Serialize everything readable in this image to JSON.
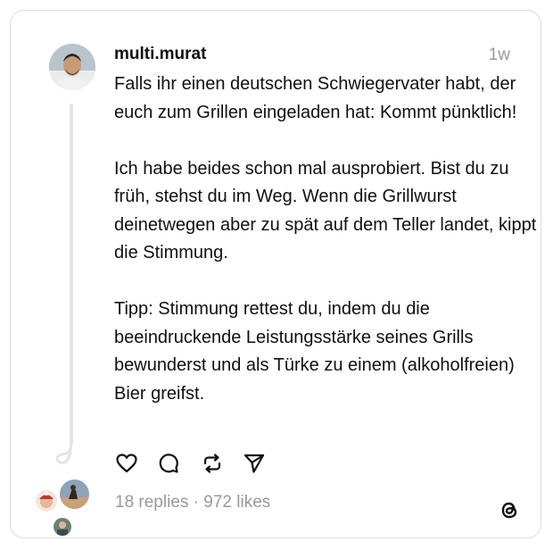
{
  "post": {
    "username": "multi.murat",
    "timestamp": "1w",
    "paragraphs": [
      "Falls ihr einen deutschen Schwiegervater habt, der euch zum Grillen eingeladen hat: Kommt pünktlich!",
      "Ich habe beides schon mal ausprobiert. Bist du zu früh, stehst du im Weg. Wenn die Grillwurst deinetwegen aber zu spät auf dem Teller landet, kippt die Stimmung.",
      "Tipp: Stimmung rettest du, indem du die beeindruckende Leistungsstärke seines Grills bewunderst und als Türke zu einem (alkoholfreien) Bier greifst."
    ]
  },
  "actions": {
    "like_icon": "heart-icon",
    "reply_icon": "comment-icon",
    "repost_icon": "repost-icon",
    "share_icon": "send-icon"
  },
  "stats": {
    "summary": "18 replies · 972 likes"
  },
  "branding": {
    "logo": "threads-logo-icon"
  },
  "colors": {
    "text": "#101010",
    "muted": "#999999",
    "border": "#dcdcdc",
    "thread_line": "#e4e4e4"
  }
}
